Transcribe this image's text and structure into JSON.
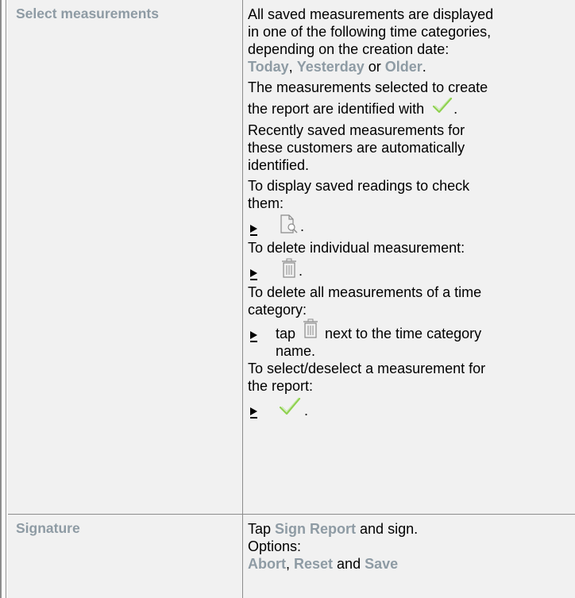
{
  "rows": [
    {
      "label": "Select measurements",
      "lines": {
        "l1": "All saved measurements are displayed",
        "l2": "in one of the following time categories,",
        "l3": "depending on the creation date:",
        "today": "Today",
        "comma1": ", ",
        "yesterday": "Yesterday",
        "or": " or ",
        "older": "Older",
        "period1": ".",
        "l5": "The measurements selected to create",
        "l6": "the report are identified with",
        "period2": ".",
        "l7": "Recently saved measurements for",
        "l8": "these customers are automatically",
        "l9": "identified.",
        "l10": "To display saved readings to check",
        "l11": "them:",
        "period3": ".",
        "l12": "To delete individual measurement:",
        "period4": ".",
        "l13": "To delete all measurements of a time",
        "l14": "category:",
        "tap": "tap",
        "l15a": "next to the time category",
        "l15b": "name.",
        "l16": "To select/deselect a measurement for",
        "l17": "the report:",
        "period5": "."
      }
    },
    {
      "label": "Signature",
      "lines": {
        "tap": "Tap ",
        "sign_report": "Sign Report",
        "and_sign": " and sign.",
        "options": "Options:",
        "abort": "Abort",
        "comma": ", ",
        "reset": "Reset",
        "and": " and ",
        "save": "Save"
      }
    }
  ],
  "icons": {
    "check": "check-icon",
    "view": "document-search-icon",
    "trash": "trash-icon"
  },
  "colors": {
    "highlight": "#8e9ba4",
    "check": "#8fd14f",
    "cell_bg": "#f1f1f1",
    "border": "#8c8c8c"
  }
}
